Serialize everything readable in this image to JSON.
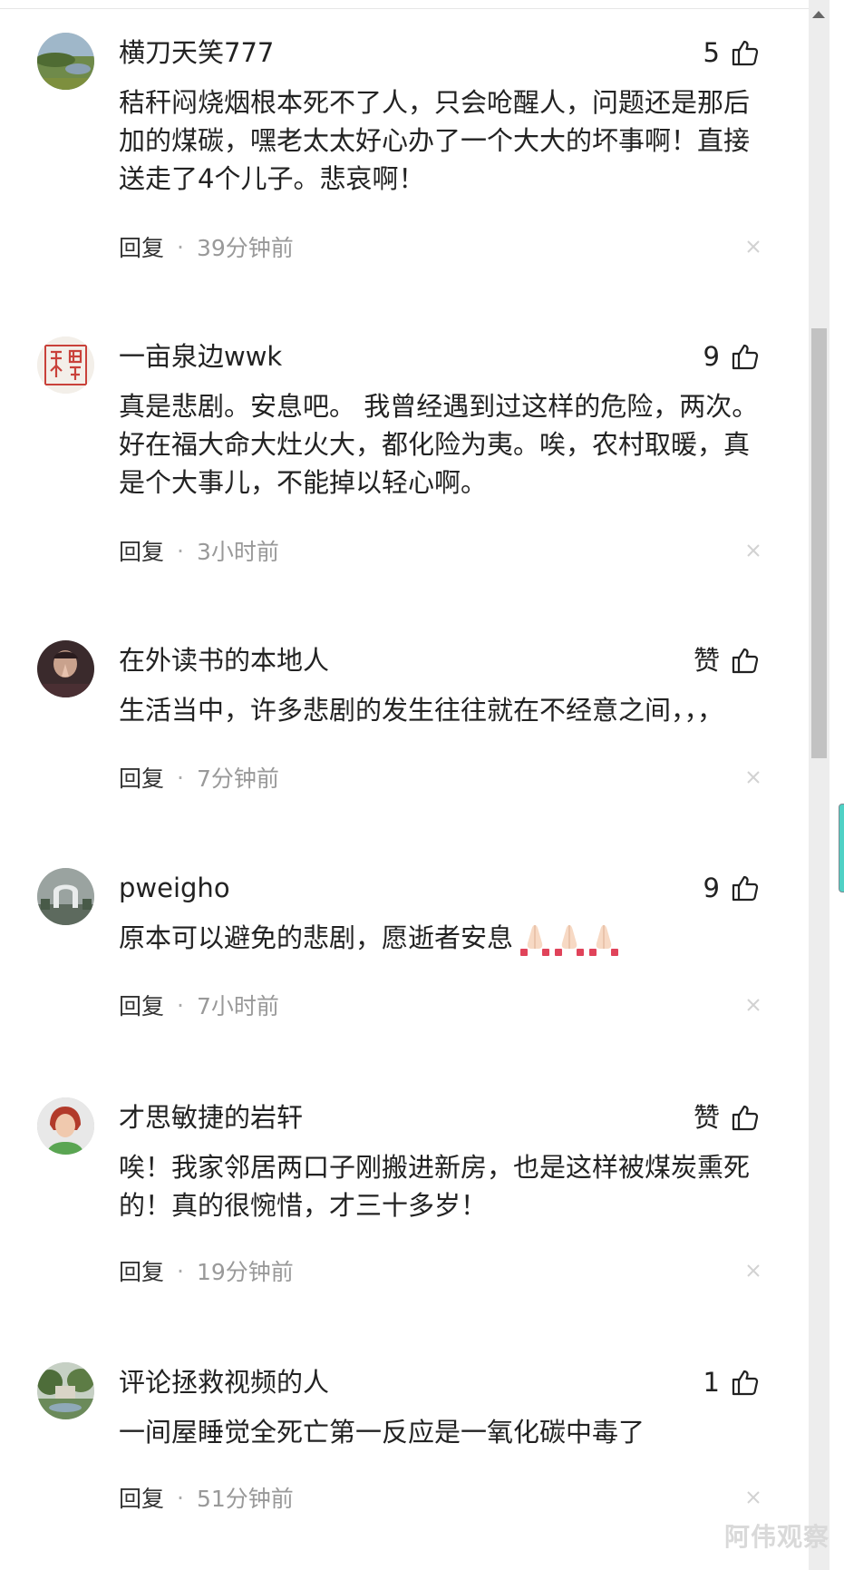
{
  "comments": [
    {
      "username": "横刀天笑777",
      "likes": "5",
      "text": "秸秆闷烧烟根本死不了人，只会呛醒人，问题还是那后加的煤碳，嘿老太太好心办了一个大大的坏事啊！直接送走了4个儿子。悲哀啊！",
      "reply_label": "回复",
      "time": "39分钟前"
    },
    {
      "username": "一亩泉边wwk",
      "likes": "9",
      "text": "真是悲剧。安息吧。 我曾经遇到过这样的危险，两次。好在福大命大灶火大，都化险为夷。唉，农村取暖，真是个大事儿，不能掉以轻心啊。",
      "reply_label": "回复",
      "time": "3小时前"
    },
    {
      "username": "在外读书的本地人",
      "likes": "赞",
      "text": "生活当中，许多悲剧的发生往往就在不经意之间，，，",
      "reply_label": "回复",
      "time": "7分钟前"
    },
    {
      "username": "pweigho",
      "likes": "9",
      "text": "原本可以避免的悲剧，愿逝者安息",
      "reply_label": "回复",
      "time": "7小时前"
    },
    {
      "username": "才思敏捷的岩轩",
      "likes": "赞",
      "text": "唉！我家邻居两口子刚搬进新房，也是这样被煤炭熏死的！真的很惋惜，才三十多岁！",
      "reply_label": "回复",
      "time": "19分钟前"
    },
    {
      "username": "评论拯救视频的人",
      "likes": "1",
      "text": "一间屋睡觉全死亡第一反应是一氧化碳中毒了",
      "reply_label": "回复",
      "time": "51分钟前"
    }
  ],
  "separator": "·",
  "watermark": "阿伟观察",
  "icons": {
    "like": "thumbs-up-icon",
    "close": "close-icon",
    "emoji": "folded-hands-emoji"
  },
  "colors": {
    "text": "#222222",
    "meta": "#999999",
    "scrollbar_track": "#ededed",
    "scrollbar_thumb": "#c2c2c2",
    "side_tab": "#4fd1c5"
  }
}
